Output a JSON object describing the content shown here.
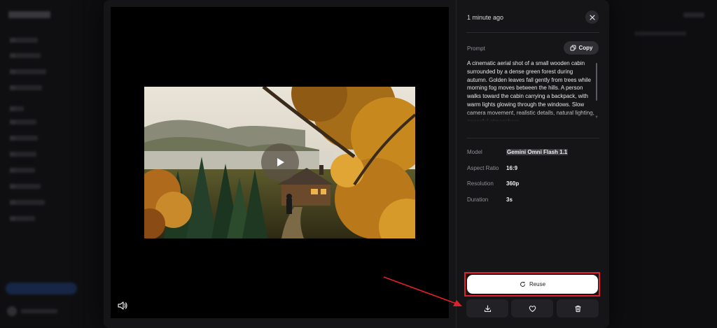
{
  "panel": {
    "timestamp": "1 minute ago",
    "prompt_label": "Prompt",
    "copy_label": "Copy",
    "prompt_text": "A cinematic aerial shot of a small wooden cabin surrounded by a dense green forest during autumn. Golden leaves fall gently from trees while morning fog moves between the hills. A person walks toward the cabin carrying a backpack, with warm lights glowing through the windows. Slow camera movement, realistic details, natural lighting, peaceful atmosphere.",
    "details": [
      {
        "label": "Model",
        "value": "Gemini Omni Flash 1.1"
      },
      {
        "label": "Aspect Ratio",
        "value": "16:9"
      },
      {
        "label": "Resolution",
        "value": "360p"
      },
      {
        "label": "Duration",
        "value": "3s"
      }
    ],
    "reuse_label": "Reuse",
    "actions": [
      "download-icon",
      "heart-icon",
      "trash-icon"
    ]
  },
  "player": {
    "controls": [
      "play-icon",
      "volume-icon"
    ]
  },
  "colors": {
    "highlight": "#e0202a",
    "panel_bg": "#151517",
    "button_bg": "#222226",
    "reuse_bg": "#ffffff"
  }
}
